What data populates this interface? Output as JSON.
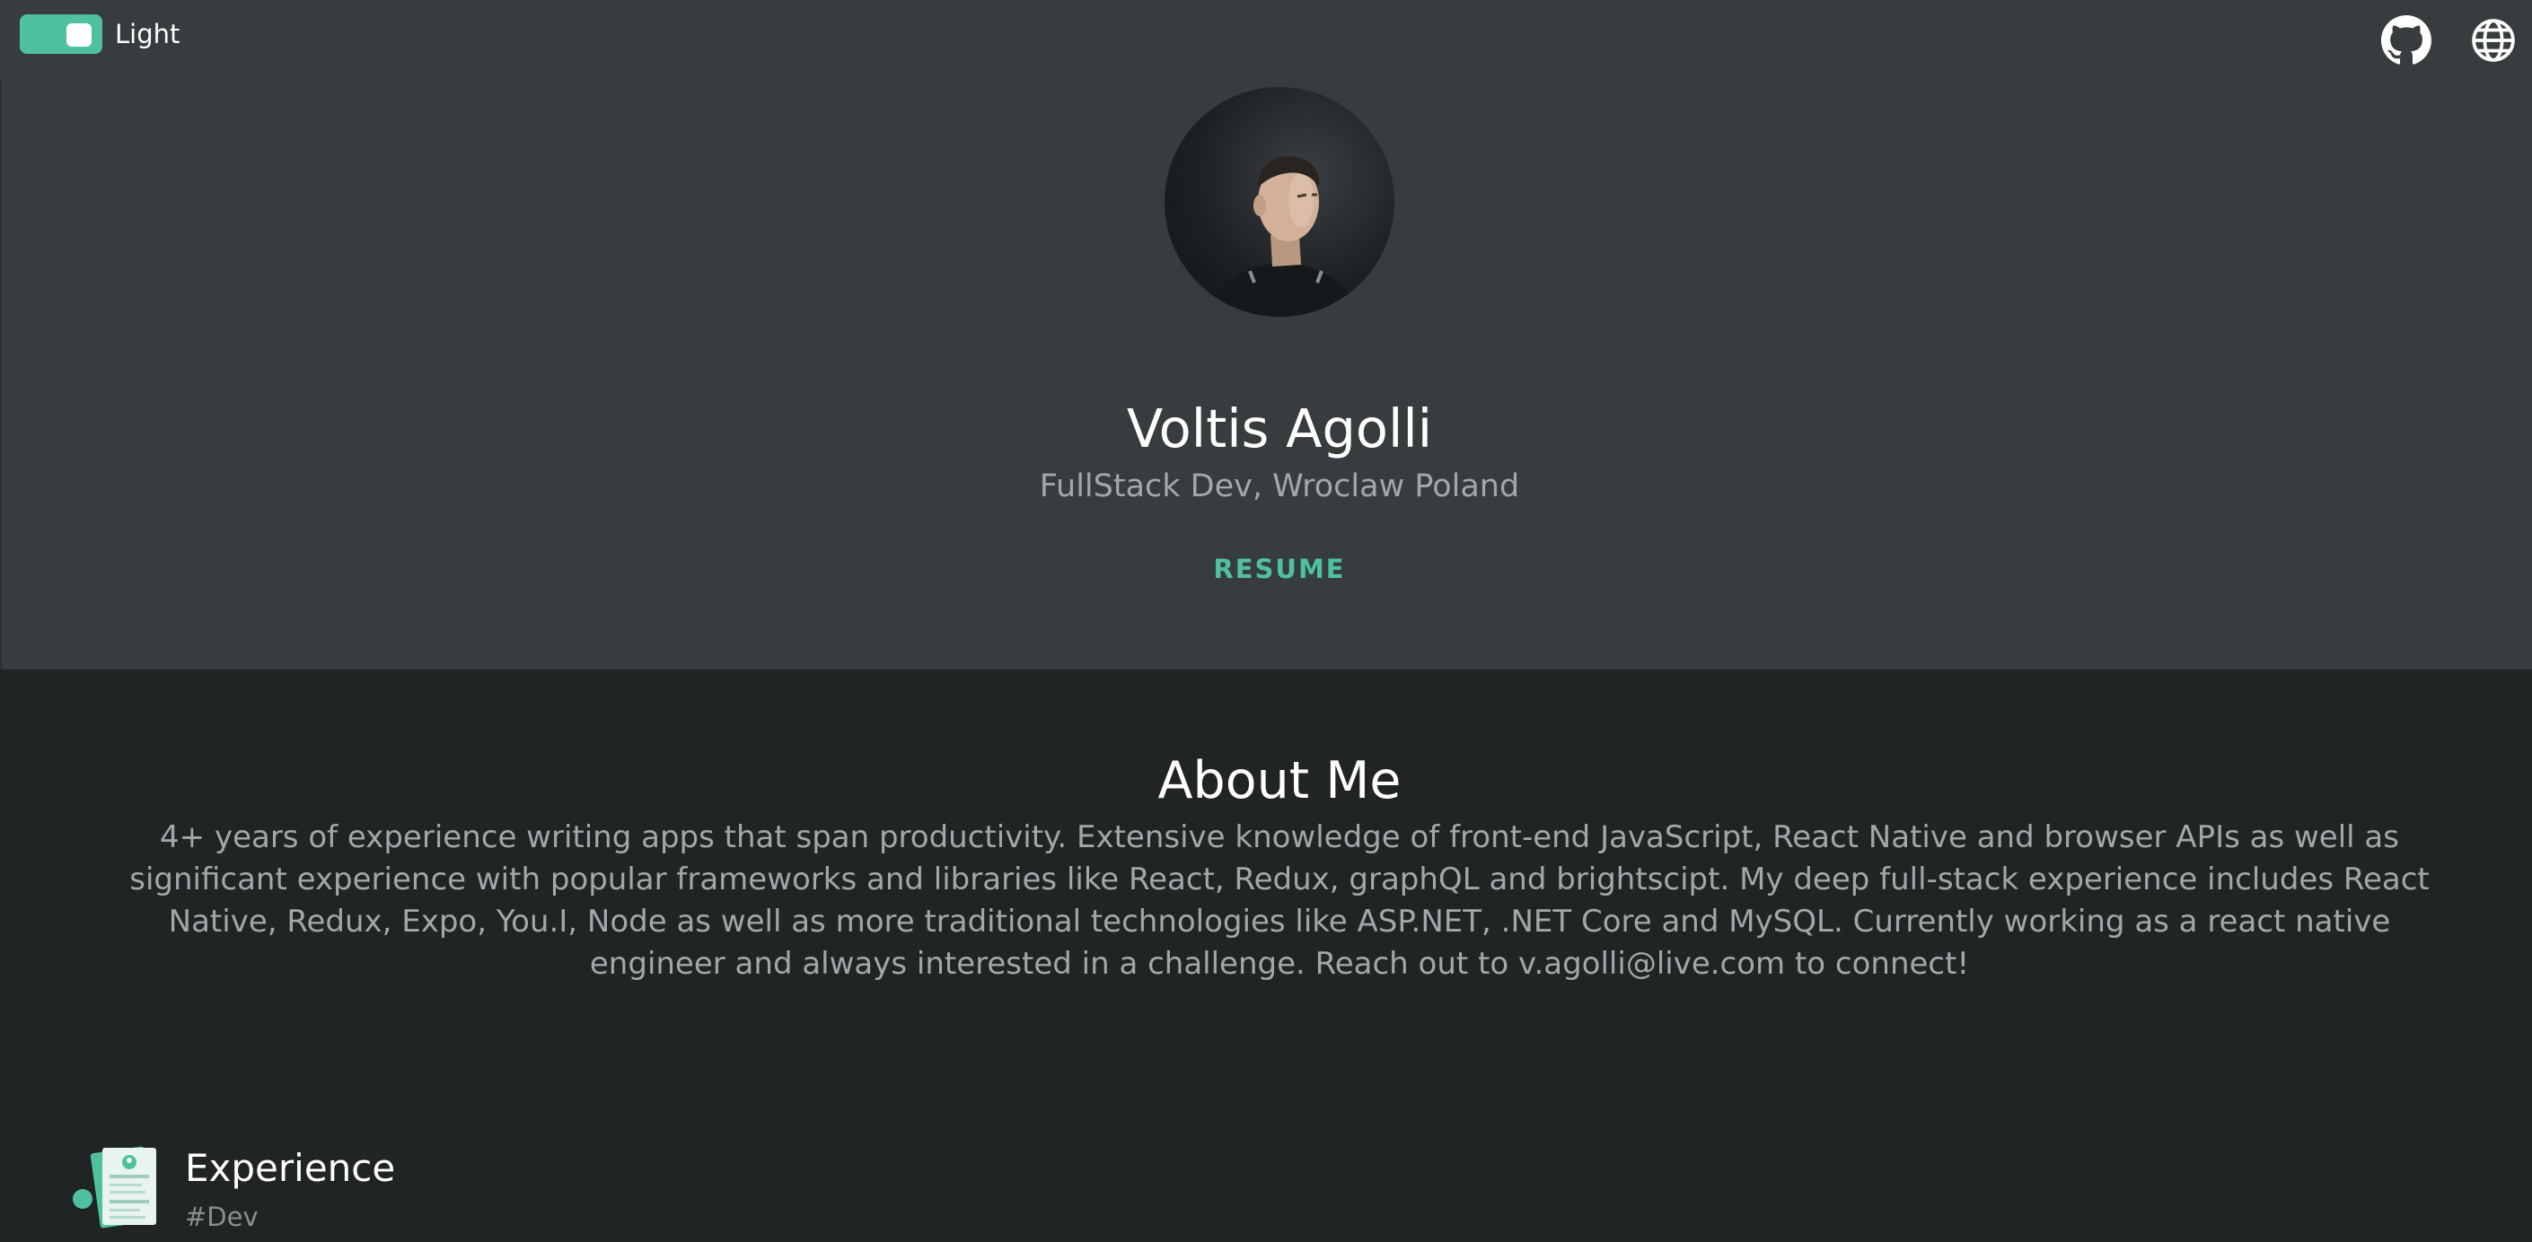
{
  "header": {
    "theme_toggle_label": "Light",
    "accent_color": "#4fc1a0",
    "icons": [
      "github-icon",
      "globe-icon"
    ]
  },
  "profile": {
    "name": "Voltis Agolli",
    "subtitle": "FullStack Dev, Wroclaw Poland",
    "resume_label": "RESUME"
  },
  "about": {
    "title": "About Me",
    "text": "4+ years of experience writing apps that span productivity. Extensive knowledge of front-end JavaScript, React Native and browser APIs as well as significant experience with popular frameworks and libraries like React, Redux, graphQL and brightscipt. My deep full-stack experience includes React Native, Redux, Expo, You.I, Node as well as more traditional technologies like ASP.NET, .NET Core and MySQL. Currently working as a react native engineer and always interested in a challenge. Reach out to v.agolli@live.com to connect!"
  },
  "experience": {
    "title": "Experience",
    "tag": "#Dev"
  }
}
